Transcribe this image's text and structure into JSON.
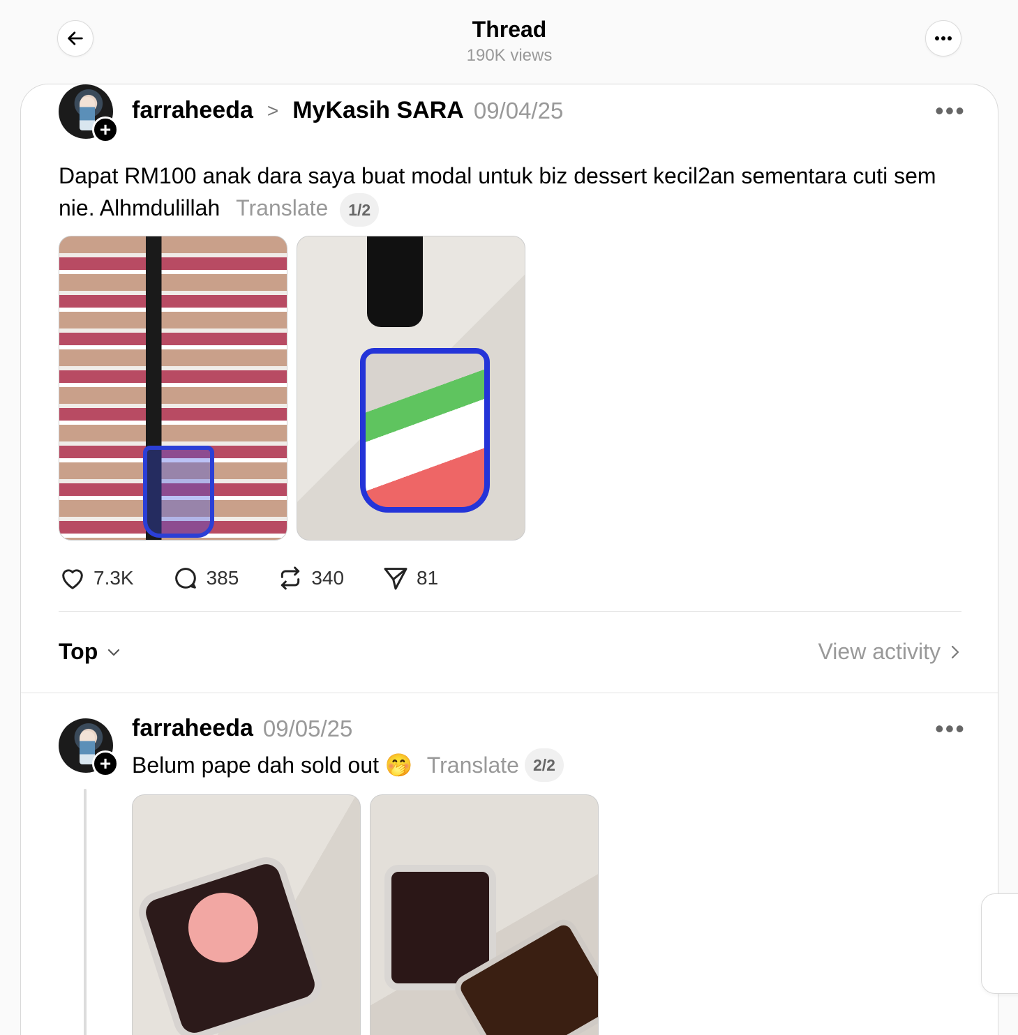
{
  "header": {
    "title": "Thread",
    "views": "190K views"
  },
  "post1": {
    "username": "farraheeda",
    "community": "MyKasih SARA",
    "date": "09/04/25",
    "text": "Dapat RM100 anak dara saya buat modal untuk biz dessert kecil2an sementara cuti sem nie. Alhmdulillah",
    "translate": "Translate",
    "page": "1/2",
    "likes": "7.3K",
    "replies": "385",
    "reposts": "340",
    "shares": "81"
  },
  "sort": {
    "label": "Top",
    "view_activity": "View activity"
  },
  "post2": {
    "username": "farraheeda",
    "date": "09/05/25",
    "text": "Belum pape dah sold out 🤭",
    "translate": "Translate",
    "page": "2/2"
  }
}
